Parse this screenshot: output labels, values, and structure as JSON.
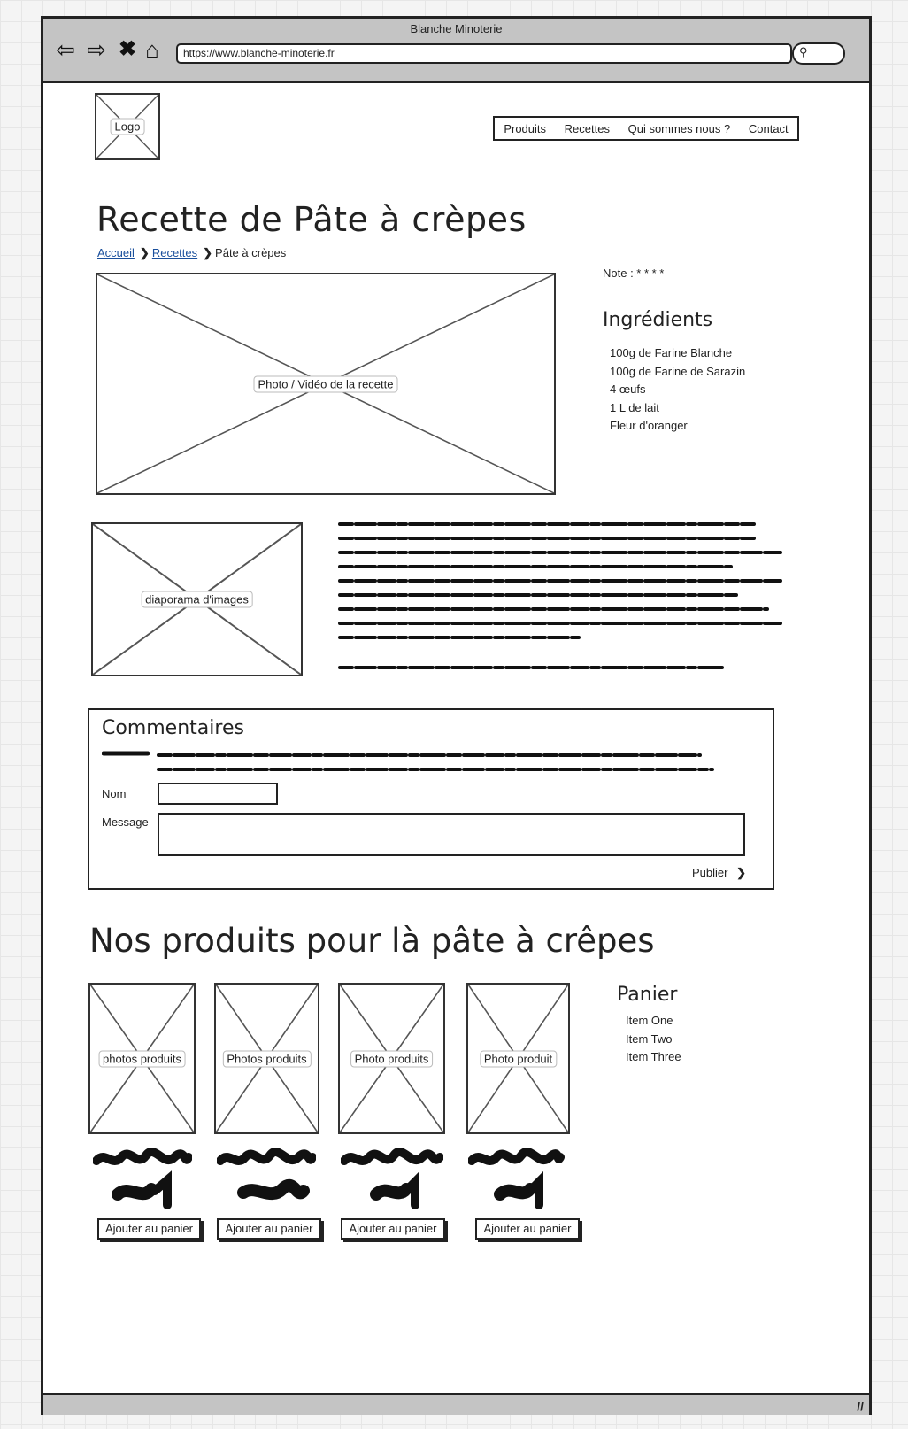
{
  "window": {
    "title": "Blanche Minoterie",
    "url": "https://www.blanche-minoterie.fr"
  },
  "logo": {
    "label": "Logo"
  },
  "menu": [
    "Produits",
    "Recettes",
    "Qui sommes nous ?",
    "Contact"
  ],
  "page": {
    "title": "Recette de Pâte à crèpes",
    "breadcrumb": {
      "home": "Accueil",
      "section": "Recettes",
      "current": "Pâte à crèpes"
    },
    "media_label": "Photo / Vidéo de la recette",
    "rating_label": "Note : * * * *",
    "ingredients_title": "Ingrédients",
    "ingredients": [
      "100g de Farine Blanche",
      "100g de Farine de Sarazin",
      "4 œufs",
      "1 L de lait",
      "Fleur d'oranger"
    ],
    "slideshow_label": "diaporama d'images"
  },
  "comments": {
    "title": "Commentaires",
    "name_label": "Nom",
    "message_label": "Message",
    "publish_label": "Publier"
  },
  "products": {
    "title": "Nos produits pour là pâte à crêpes",
    "items": [
      {
        "photo_label": "photos produits",
        "button": "Ajouter au panier"
      },
      {
        "photo_label": "Photos produits",
        "button": "Ajouter au panier"
      },
      {
        "photo_label": "Photo produits",
        "button": "Ajouter au panier"
      },
      {
        "photo_label": "Photo produit",
        "button": "Ajouter au panier"
      }
    ]
  },
  "cart": {
    "title": "Panier",
    "items": [
      "Item One",
      "Item Two",
      "Item Three"
    ]
  }
}
